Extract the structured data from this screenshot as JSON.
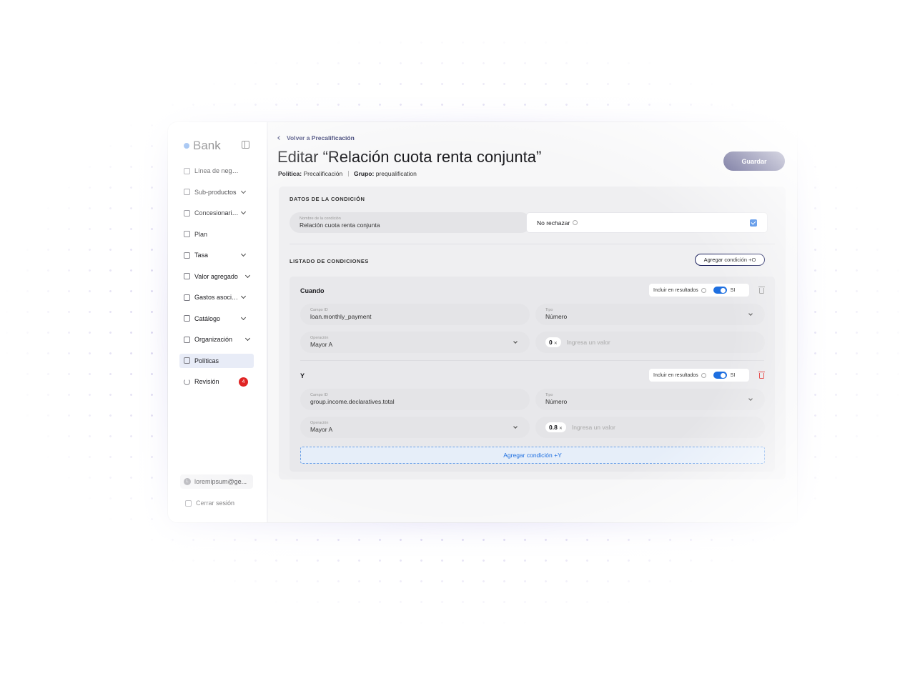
{
  "sidebar": {
    "brand": "Bank",
    "items": [
      {
        "label": "Línea de negocio",
        "icon": "briefcase-icon",
        "chevron": false
      },
      {
        "label": "Sub-productos",
        "icon": "car-icon",
        "chevron": true
      },
      {
        "label": "Concesionarios",
        "icon": "store-icon",
        "chevron": true
      },
      {
        "label": "Plan",
        "icon": "clipboard-icon",
        "chevron": false
      },
      {
        "label": "Tasa",
        "icon": "percent-icon",
        "chevron": true
      },
      {
        "label": "Valor agregado",
        "icon": "document-icon",
        "chevron": true
      },
      {
        "label": "Gastos asociados",
        "icon": "receipt-icon",
        "chevron": true
      },
      {
        "label": "Catálogo",
        "icon": "folder-icon",
        "chevron": true
      },
      {
        "label": "Organización",
        "icon": "building-icon",
        "chevron": true
      },
      {
        "label": "Políticas",
        "icon": "policy-icon",
        "chevron": false,
        "active": true
      },
      {
        "label": "Revisión",
        "icon": "refresh-icon",
        "chevron": false,
        "badge": "4"
      }
    ],
    "user_initial": "L",
    "user_email": "loremipsum@ge...",
    "logout_label": "Cerrar sesión"
  },
  "header": {
    "back_label": "Volver a Precalificación",
    "title": "Editar “Relación cuota renta conjunta”",
    "policy_label": "Política:",
    "policy_value": "Precalificación",
    "group_label": "Grupo:",
    "group_value": "prequalification",
    "save_label": "Guardar"
  },
  "condition_data": {
    "section_title": "DATOS DE LA CONDICIÓN",
    "name_label": "Nombre de la condición",
    "name_value": "Relación cuota renta conjunta",
    "no_reject_label": "No rechazar",
    "no_reject_checked": true
  },
  "conditions": {
    "section_title": "LISTADO DE CONDICIONES",
    "add_or_label": "Agregar condición +O",
    "include_label": "Incluir en resultados",
    "toggle_label": "SI",
    "rows": [
      {
        "heading": "Cuando",
        "field_id_label": "Campo ID",
        "field_id_value": "loan.monthly_payment",
        "type_label": "Tipo",
        "type_value": "Número",
        "operation_label": "Operación",
        "operation_value": "Mayor A",
        "chip_value": "0",
        "value_placeholder": "Ingresa un valor"
      },
      {
        "heading": "Y",
        "field_id_label": "Campo ID",
        "field_id_value": "group.income.declaratives.total",
        "type_label": "Tipo",
        "type_value": "Número",
        "operation_label": "Operación",
        "operation_value": "Mayor A",
        "chip_value": "0.8",
        "value_placeholder": "Ingresa un valor"
      }
    ],
    "add_and_label": "Agregar condición +Y",
    "accent_color": "#1e6fe0",
    "danger_color": "#e02424",
    "primary_color": "#1a1a5e"
  }
}
